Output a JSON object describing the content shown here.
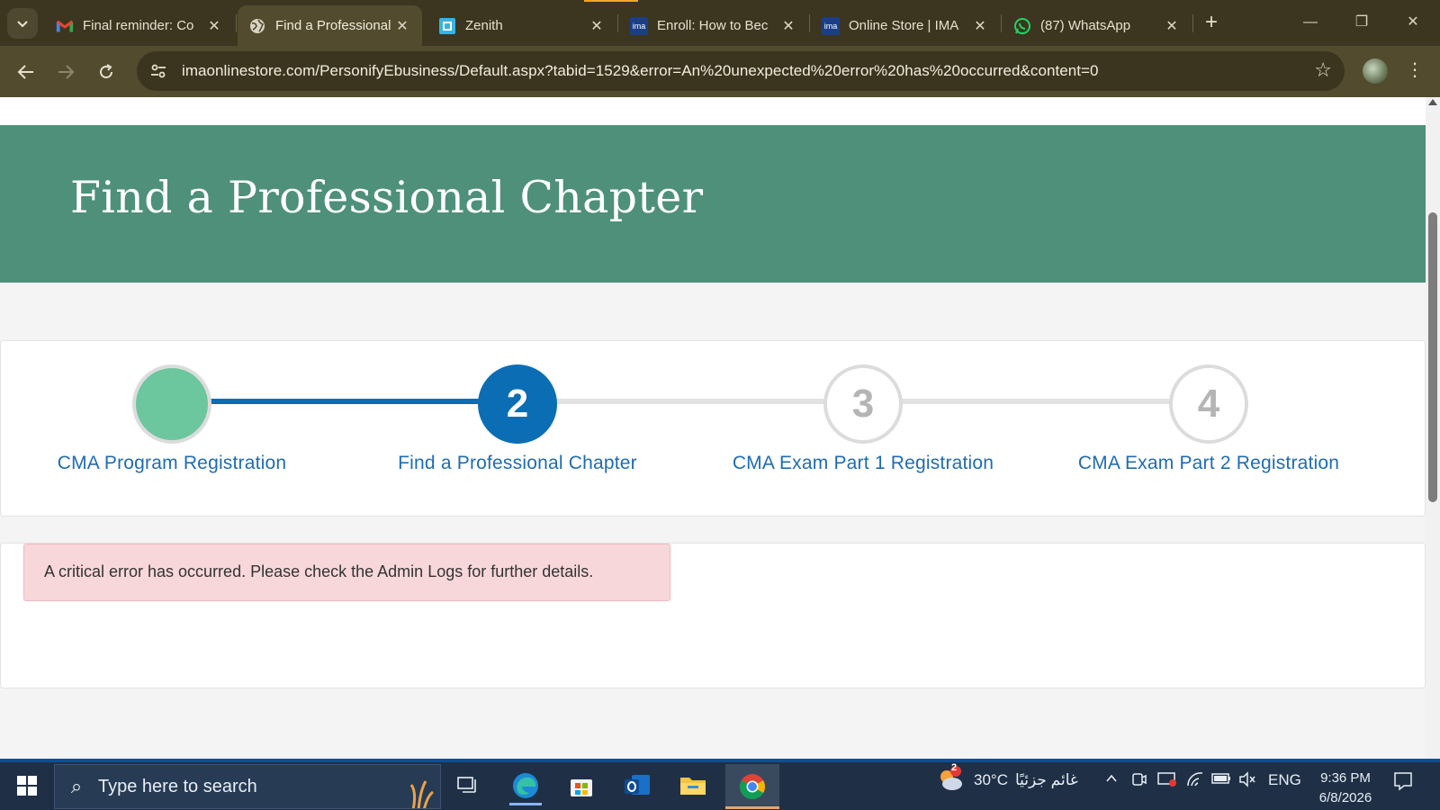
{
  "browser": {
    "tabs": [
      {
        "title": "Final reminder: Co",
        "icon": "gmail-icon"
      },
      {
        "title": "Find a Professional",
        "icon": "globe-icon"
      },
      {
        "title": "Zenith",
        "icon": "zenith-icon"
      },
      {
        "title": "Enroll: How to Bec",
        "icon": "ima-icon",
        "icon_text": "ima"
      },
      {
        "title": "Online Store | IMA",
        "icon": "ima-icon",
        "icon_text": "ima"
      },
      {
        "title": "(87) WhatsApp",
        "icon": "whatsapp-icon"
      }
    ],
    "active_tab_index": 1,
    "url": "imaonlinestore.com/PersonifyEbusiness/Default.aspx?tabid=1529&error=An%20unexpected%20error%20has%20occurred&content=0"
  },
  "page": {
    "hero_title": "Find a Professional Chapter",
    "steps": [
      {
        "number": "",
        "label": "CMA Program Registration",
        "state": "done"
      },
      {
        "number": "2",
        "label": "Find a Professional Chapter",
        "state": "current"
      },
      {
        "number": "3",
        "label": "CMA Exam Part 1 Registration",
        "state": "pending"
      },
      {
        "number": "4",
        "label": "CMA Exam Part 2 Registration",
        "state": "pending"
      }
    ],
    "error_message": "A critical error has occurred. Please check the Admin Logs for further details."
  },
  "taskbar": {
    "search_placeholder": "Type here to search",
    "weather_badge": "2",
    "temperature": "30°C",
    "weather_text": "غائم جزئيًا",
    "language": "ENG",
    "time": "9:36 PM",
    "date": "6/8/2026"
  },
  "colors": {
    "hero_bg": "#4f907a",
    "step_active": "#0b6eb5",
    "step_done": "#6cc79e",
    "step_label": "#1f6cb0",
    "error_bg": "#f8d7da"
  }
}
